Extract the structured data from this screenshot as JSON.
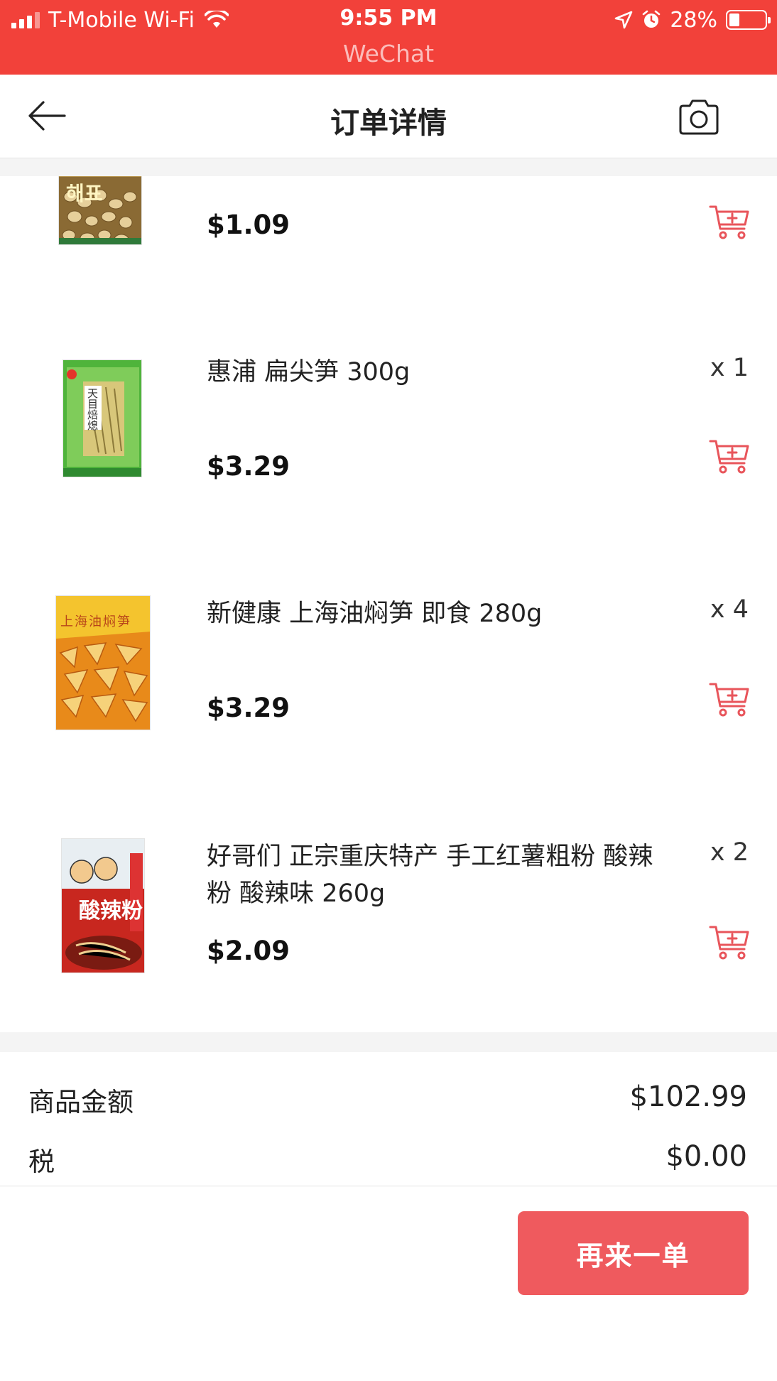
{
  "status_bar": {
    "carrier": "T-Mobile Wi-Fi",
    "time": "9:55 PM",
    "battery": "28%",
    "battery_level": 0.28,
    "app": "WeChat"
  },
  "nav": {
    "title": "订单详情"
  },
  "items": [
    {
      "name": "",
      "qty": "",
      "price": "$1.09",
      "image_text": "해표"
    },
    {
      "name": "惠浦 扁尖笋 300g",
      "qty": "x 1",
      "price": "$3.29",
      "image_text": "天目焙熄"
    },
    {
      "name": "新健康 上海油焖笋 即食 280g",
      "qty": "x 4",
      "price": "$3.29",
      "image_text": "上海油焖笋"
    },
    {
      "name": "好哥们 正宗重庆特产 手工红薯粗粉 酸辣粉 酸辣味 260g",
      "qty": "x 2",
      "price": "$2.09",
      "image_text": "酸辣粉"
    }
  ],
  "summary": {
    "subtotal_label": "商品金额",
    "subtotal_value": "$102.99",
    "tax_label": "税",
    "tax_value": "$0.00"
  },
  "actions": {
    "reorder_label": "再来一单"
  },
  "colors": {
    "status_bar": "#f2413a",
    "accent": "#ef5a5e",
    "cart_icon": "#e8555b"
  }
}
